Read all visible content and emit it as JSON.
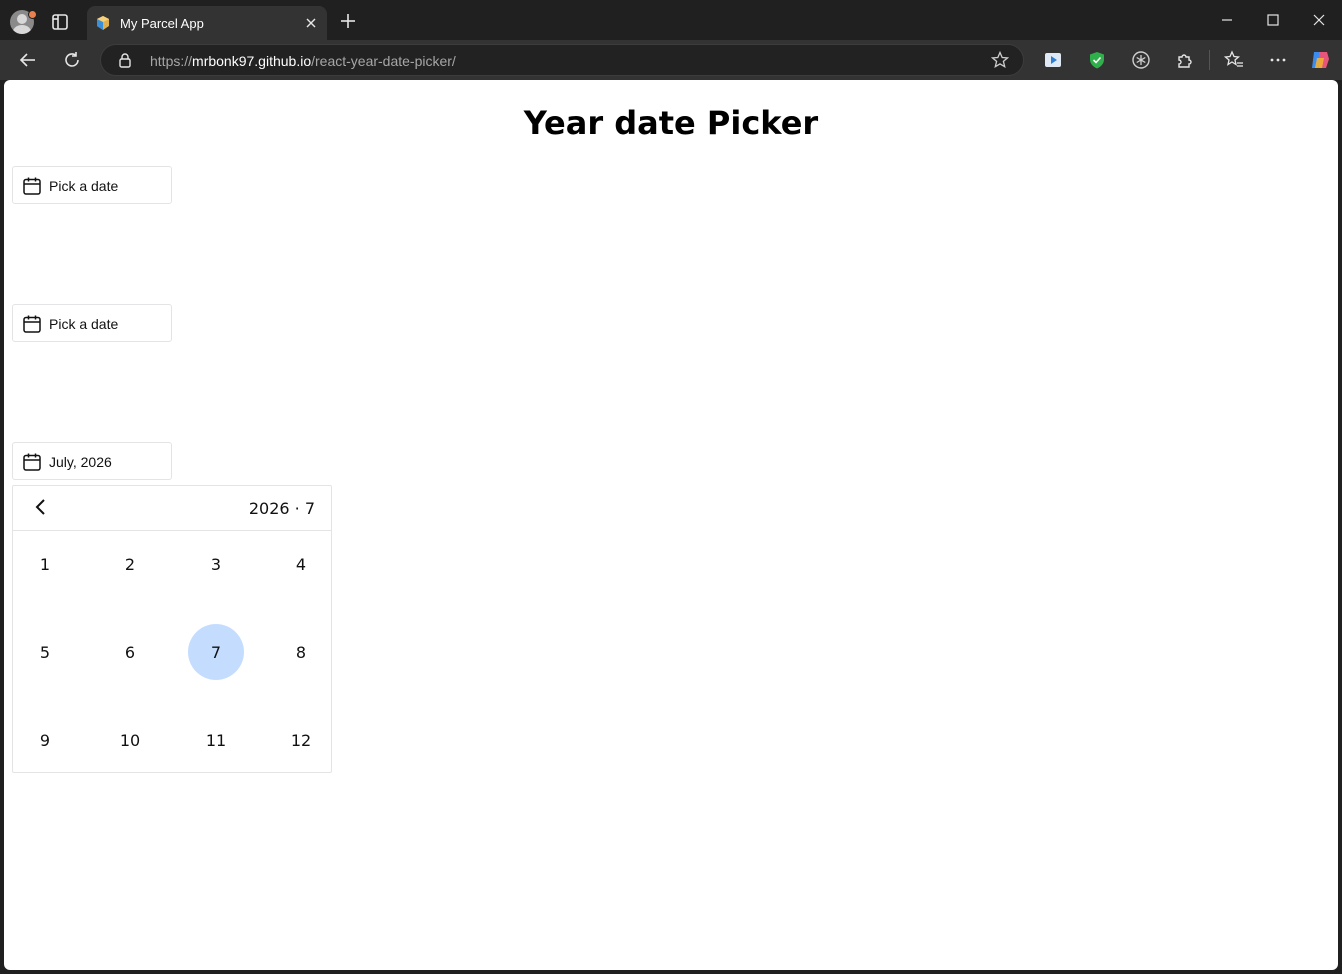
{
  "browser": {
    "tab_title": "My Parcel App",
    "url_scheme": "https://",
    "url_host": "mrbonk97.github.io",
    "url_path": "/react-year-date-picker/"
  },
  "page": {
    "title": "Year date Picker",
    "pickers": [
      {
        "label": "Pick a date"
      },
      {
        "label": "Pick a date"
      },
      {
        "label": "July, 2026"
      }
    ],
    "calendar": {
      "caption": "2026 · 7",
      "months": [
        "1",
        "2",
        "3",
        "4",
        "5",
        "6",
        "7",
        "8",
        "9",
        "10",
        "11",
        "12"
      ],
      "selected": "7"
    }
  },
  "colors": {
    "selected_bg": "#c4ddff",
    "chrome_dark": "#202020",
    "toolbar": "#333333"
  }
}
